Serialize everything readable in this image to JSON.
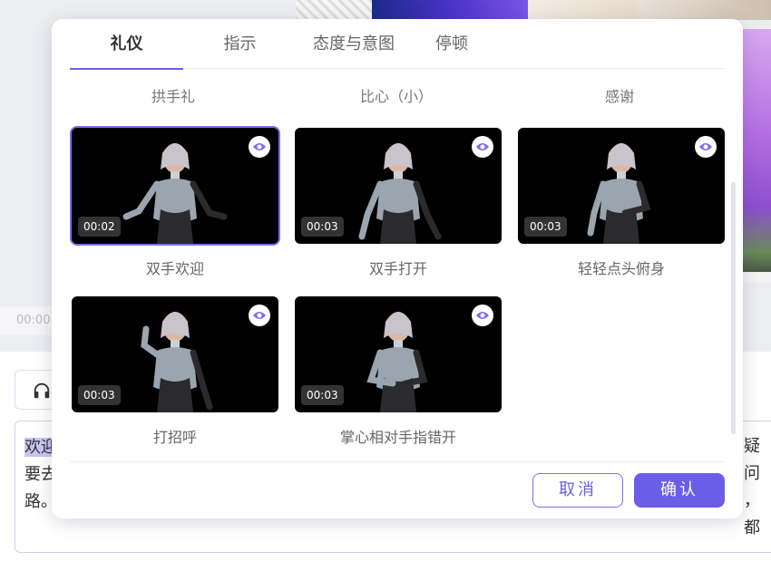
{
  "background": {
    "time_chip": "00:00",
    "text_highlight": "欢迎",
    "text_line2": "要去",
    "text_line3": "路。",
    "right_fragment_1": "疑问",
    "right_fragment_2": "，都"
  },
  "modal": {
    "tabs": [
      {
        "label": "礼仪",
        "active": true
      },
      {
        "label": "指示",
        "active": false
      },
      {
        "label": "态度与意图",
        "active": false
      },
      {
        "label": "停顿",
        "active": false
      }
    ],
    "top_labels": [
      "拱手礼",
      "比心（小）",
      "感谢"
    ],
    "cards": [
      {
        "label": "双手欢迎",
        "duration": "00:02",
        "selected": true
      },
      {
        "label": "双手打开",
        "duration": "00:03",
        "selected": false
      },
      {
        "label": "轻轻点头俯身",
        "duration": "00:03",
        "selected": false
      },
      {
        "label": "打招呼",
        "duration": "00:03",
        "selected": false
      },
      {
        "label": "掌心相对手指错开",
        "duration": "00:03",
        "selected": false
      }
    ],
    "cancel_label": "取消",
    "confirm_label": "确认"
  },
  "colors": {
    "accent": "#6a5ee8",
    "card_bg": "#000000"
  }
}
